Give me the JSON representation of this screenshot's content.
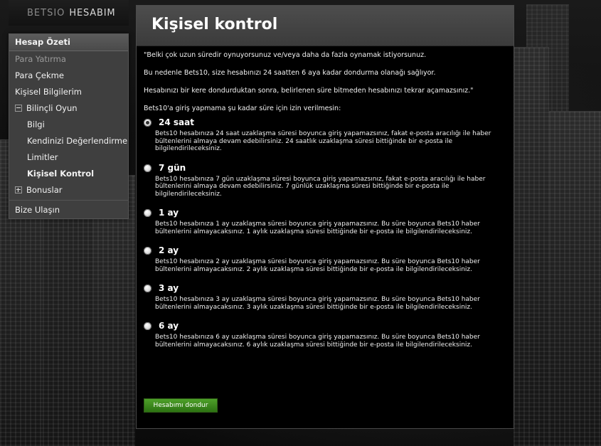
{
  "logo": {
    "brand": "BETSIO",
    "title": "HESABIM"
  },
  "sidebar": {
    "items": [
      {
        "label": "Hesap Özeti"
      },
      {
        "label": "Para Yatırma"
      },
      {
        "label": "Para Çekme"
      },
      {
        "label": "Kişisel Bilgilerim"
      },
      {
        "label": "Bilinçli Oyun"
      },
      {
        "label": "Bilgi"
      },
      {
        "label": "Kendinizi Değerlendirme"
      },
      {
        "label": "Limitler"
      },
      {
        "label": "Kişisel Kontrol"
      },
      {
        "label": "Bonuslar"
      },
      {
        "label": "Bize Ulaşın"
      }
    ]
  },
  "main": {
    "title": "Kişisel kontrol",
    "intro": [
      "\"Belki çok uzun süredir oynuyorsunuz ve/veya daha da fazla oynamak istiyorsunuz.",
      "Bu nedenle Bets10, size hesabınızı 24 saatten 6 aya kadar dondurma olanağı sağlıyor.",
      "Hesabınızı bir kere dondurduktan sonra, belirlenen süre bitmeden hesabınızı tekrar açamazsınız.\"",
      "Bets10'a giriş yapmama şu kadar süre için izin verilmesin:"
    ],
    "options": [
      {
        "title": "24 saat",
        "desc": "Bets10 hesabınıza 24 saat uzaklaşma süresi boyunca giriş yapamazsınız, fakat e-posta aracılığı ile haber bültenlerini almaya devam edebilirsiniz. 24 saatlık uzaklaşma süresi bittiğinde bir e-posta ile bilgilendirileceksiniz."
      },
      {
        "title": "7 gün",
        "desc": "Bets10 hesabınıza 7 gün uzaklaşma süresi boyunca giriş yapamazsınız, fakat e-posta aracılığı ile haber bültenlerini almaya devam edebilirsiniz. 7 günlük uzaklaşma süresi bittiğinde bir e-posta ile bilgilendirileceksiniz."
      },
      {
        "title": "1 ay",
        "desc": "Bets10 hesabınıza 1 ay uzaklaşma süresi boyunca giriş yapamazsınız. Bu süre boyunca Bets10 haber bültenlerini almayacaksınız. 1 aylık uzaklaşma süresi bittiğinde bir e-posta ile bilgilendirileceksiniz."
      },
      {
        "title": "2 ay",
        "desc": "Bets10 hesabınıza 2 ay uzaklaşma süresi boyunca giriş yapamazsınız. Bu süre boyunca Bets10 haber bültenlerini almayacaksınız. 2 aylık uzaklaşma süresi bittiğinde bir e-posta ile bilgilendirileceksiniz."
      },
      {
        "title": "3 ay",
        "desc": "Bets10 hesabınıza 3 ay uzaklaşma süresi boyunca giriş yapamazsınız. Bu süre boyunca Bets10 haber bültenlerini almayacaksınız. 3 aylık uzaklaşma süresi bittiğinde bir e-posta ile bilgilendirileceksiniz."
      },
      {
        "title": "6 ay",
        "desc": "Bets10 hesabınıza 6 ay uzaklaşma süresi boyunca giriş yapamazsınız. Bu süre boyunca Bets10 haber bültenlerini almayacaksınız. 6 aylık uzaklaşma süresi bittiğinde bir e-posta ile bilgilendirileceksiniz."
      }
    ],
    "selected_option": "24 saat",
    "submit_label": "Hesabımı dondur"
  }
}
